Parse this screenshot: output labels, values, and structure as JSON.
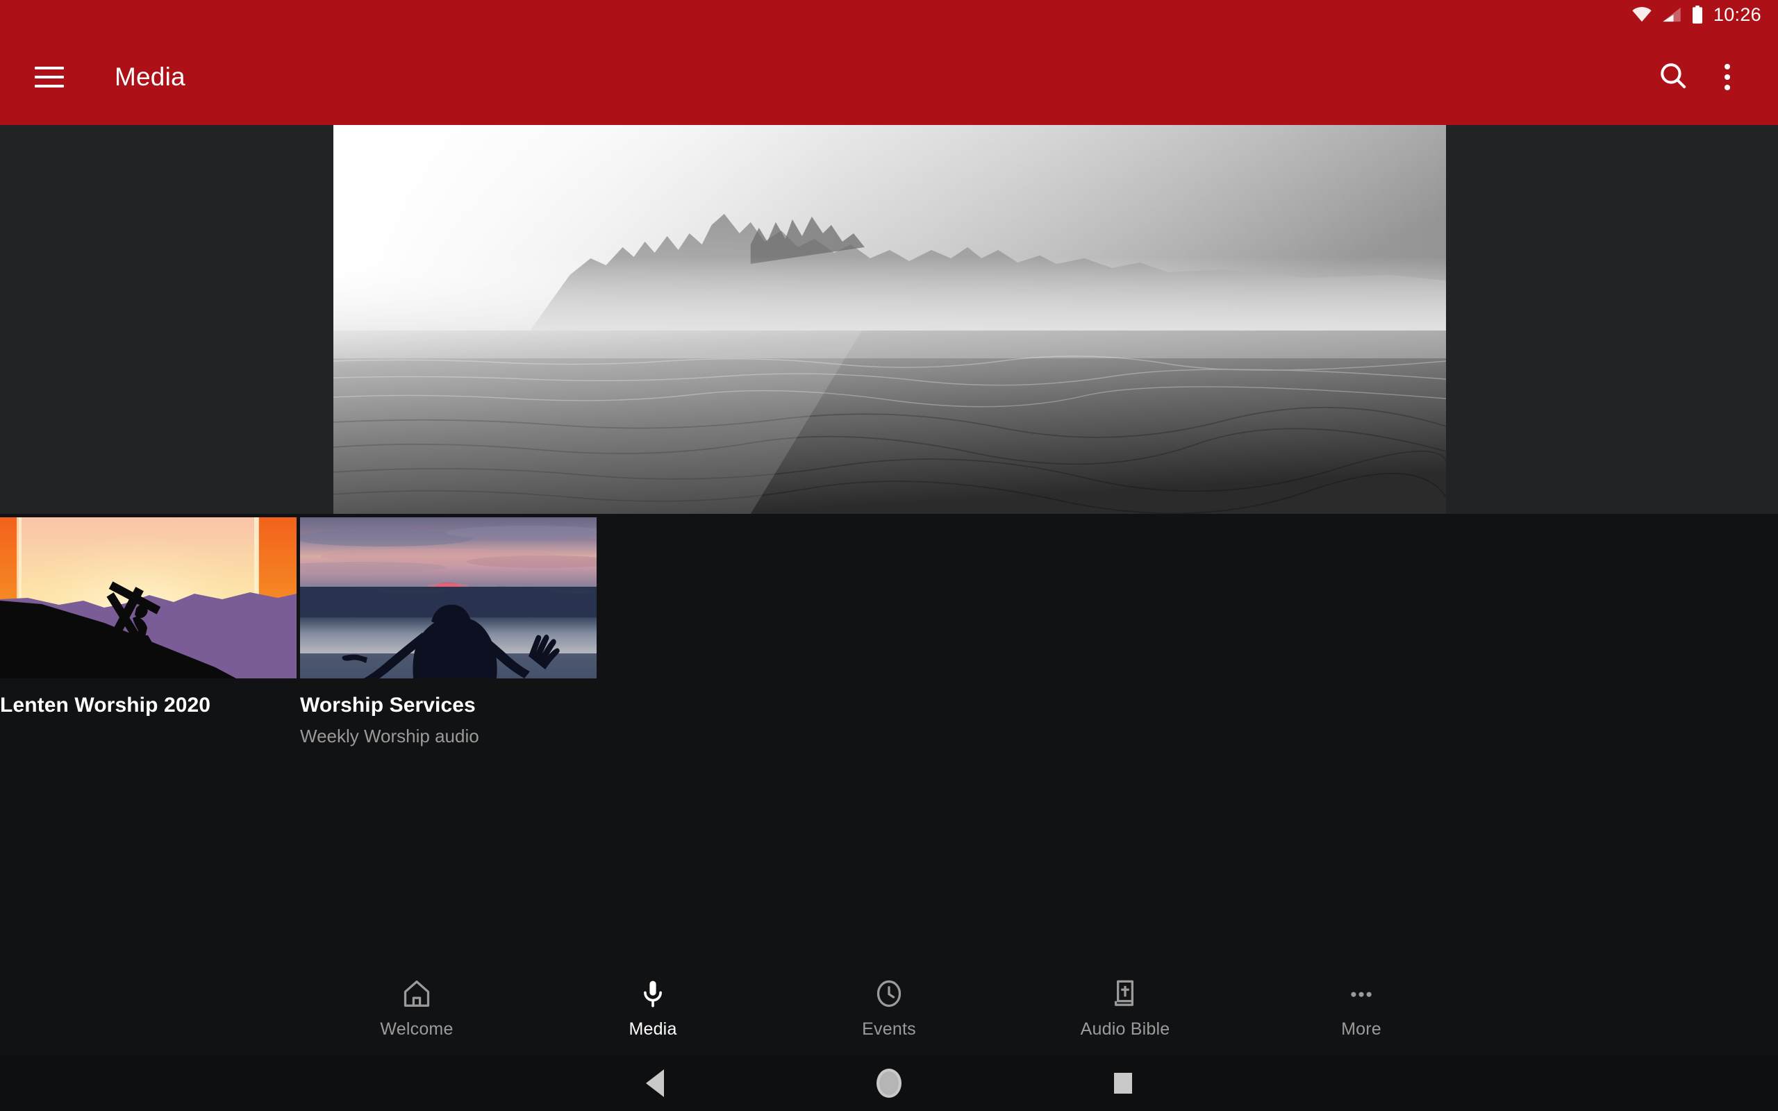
{
  "statusbar": {
    "time": "10:26",
    "icons": [
      "wifi-icon",
      "cellular-signal-icon",
      "battery-icon"
    ]
  },
  "appbar": {
    "menu_icon": "hamburger-menu-icon",
    "title": "Media",
    "search_icon": "search-icon",
    "overflow_icon": "overflow-menu-icon",
    "background_color": "#AD1016"
  },
  "hero": {
    "image_alt": "Grayscale photo of misty mountains over a lake",
    "background_color": "#222324"
  },
  "cards": [
    {
      "title": "Lenten Worship 2020",
      "subtitle": "",
      "thumb_alt": "Silhouette of a figure carrying a cross at sunset"
    },
    {
      "title": "Worship Services",
      "subtitle": "Weekly Worship audio",
      "thumb_alt": "Silhouette of a person with raised arms at sunset over water"
    }
  ],
  "bottom_nav": {
    "items": [
      {
        "label": "Welcome",
        "icon": "home-icon",
        "active": false
      },
      {
        "label": "Media",
        "icon": "microphone-icon",
        "active": true
      },
      {
        "label": "Events",
        "icon": "clock-icon",
        "active": false
      },
      {
        "label": "Audio Bible",
        "icon": "bible-book-icon",
        "active": false
      },
      {
        "label": "More",
        "icon": "more-dots-icon",
        "active": false
      }
    ],
    "active_color": "#ffffff",
    "inactive_color": "#9b9b9b"
  },
  "system_nav": {
    "back": "back-triangle-icon",
    "home": "home-circle-icon",
    "recents": "recents-square-icon"
  }
}
